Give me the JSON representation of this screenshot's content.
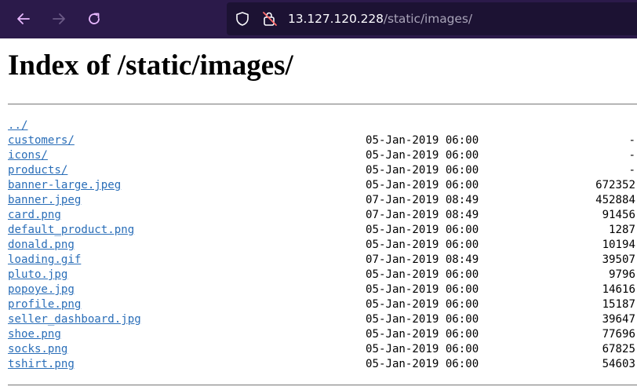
{
  "browser": {
    "url_host": "13.127.120.228",
    "url_path": "/static/images/",
    "icons": {
      "back": "back-arrow-icon",
      "forward": "forward-arrow-icon",
      "reload": "reload-icon",
      "tracking": "shield-icon",
      "insecure": "insecure-lock-icon"
    }
  },
  "page": {
    "heading": "Index of /static/images/",
    "parent_link": "../",
    "entries": [
      {
        "name": "customers/",
        "date": "05-Jan-2019 06:00",
        "size": "-"
      },
      {
        "name": "icons/",
        "date": "05-Jan-2019 06:00",
        "size": "-"
      },
      {
        "name": "products/",
        "date": "05-Jan-2019 06:00",
        "size": "-"
      },
      {
        "name": "banner-large.jpeg",
        "date": "05-Jan-2019 06:00",
        "size": "672352"
      },
      {
        "name": "banner.jpeg",
        "date": "07-Jan-2019 08:49",
        "size": "452884"
      },
      {
        "name": "card.png",
        "date": "07-Jan-2019 08:49",
        "size": "91456"
      },
      {
        "name": "default_product.png",
        "date": "05-Jan-2019 06:00",
        "size": "1287"
      },
      {
        "name": "donald.png",
        "date": "05-Jan-2019 06:00",
        "size": "10194"
      },
      {
        "name": "loading.gif",
        "date": "07-Jan-2019 08:49",
        "size": "39507"
      },
      {
        "name": "pluto.jpg",
        "date": "05-Jan-2019 06:00",
        "size": "9796"
      },
      {
        "name": "popoye.jpg",
        "date": "05-Jan-2019 06:00",
        "size": "14616"
      },
      {
        "name": "profile.png",
        "date": "05-Jan-2019 06:00",
        "size": "15187"
      },
      {
        "name": "seller_dashboard.jpg",
        "date": "05-Jan-2019 06:00",
        "size": "39647"
      },
      {
        "name": "shoe.png",
        "date": "05-Jan-2019 06:00",
        "size": "77696"
      },
      {
        "name": "socks.png",
        "date": "05-Jan-2019 06:00",
        "size": "67825"
      },
      {
        "name": "tshirt.png",
        "date": "05-Jan-2019 06:00",
        "size": "54603"
      }
    ]
  },
  "colors": {
    "toolbar_bg": "#2b1a4a",
    "urlbar_bg": "#1c1233",
    "link": "#2a6eb8",
    "insecure_red": "#ff6b6b",
    "icon_active": "#e8b8ff"
  }
}
